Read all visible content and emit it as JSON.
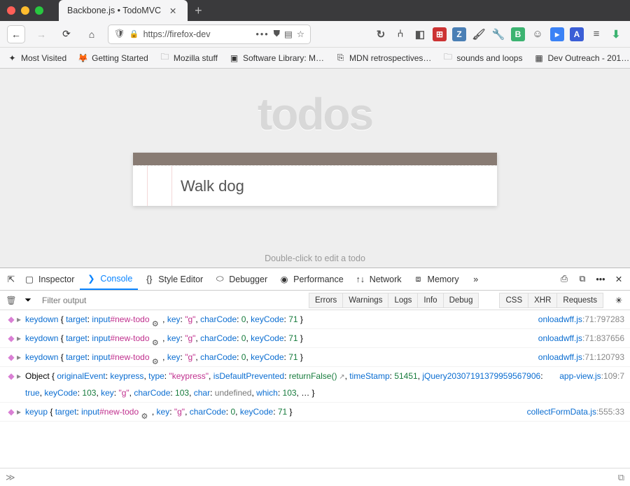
{
  "window": {
    "tab_title": "Backbone.js • TodoMVC"
  },
  "url": "https://firefox-dev",
  "bookmarks": [
    {
      "label": "Most Visited",
      "icon": "✦"
    },
    {
      "label": "Getting Started",
      "icon": "🦊"
    },
    {
      "label": "Mozilla stuff",
      "icon": "folder"
    },
    {
      "label": "Software Library: M…",
      "icon": "▣"
    },
    {
      "label": "MDN retrospectives…",
      "icon": "⎘"
    },
    {
      "label": "sounds and loops",
      "icon": "folder"
    },
    {
      "label": "Dev Outreach - 201…",
      "icon": "▦"
    }
  ],
  "app": {
    "heading": "todos",
    "input_value": "Walk dog",
    "hint": "Double-click to edit a todo"
  },
  "devtools": {
    "tabs": [
      "Inspector",
      "Console",
      "Style Editor",
      "Debugger",
      "Performance",
      "Network",
      "Memory"
    ],
    "active_tab": "Console",
    "filter_placeholder": "Filter output",
    "filter_buttons_a": [
      "Errors",
      "Warnings",
      "Logs",
      "Info",
      "Debug"
    ],
    "filter_buttons_b": [
      "CSS",
      "XHR",
      "Requests"
    ]
  },
  "console": [
    {
      "type": "keyevent",
      "html": "<span class='k-event'>keydown</span> { <span class='k-prop'>target</span>: <span class='k-sel'>input</span><span class='k-id'>#new-todo</span> <span class='gearchip'></span> , <span class='k-prop'>key</span>: <span class='k-str'>\"g\"</span>, <span class='k-prop'>charCode</span>: <span class='k-num'>0</span>, <span class='k-prop'>keyCode</span>: <span class='k-num'>71</span> }",
      "loc_file": "onloadwff.js",
      "loc_pos": "71:797283"
    },
    {
      "type": "keyevent",
      "html": "<span class='k-event'>keydown</span> { <span class='k-prop'>target</span>: <span class='k-sel'>input</span><span class='k-id'>#new-todo</span> <span class='gearchip'></span> , <span class='k-prop'>key</span>: <span class='k-str'>\"g\"</span>, <span class='k-prop'>charCode</span>: <span class='k-num'>0</span>, <span class='k-prop'>keyCode</span>: <span class='k-num'>71</span> }",
      "loc_file": "onloadwff.js",
      "loc_pos": "71:837656"
    },
    {
      "type": "keyevent",
      "html": "<span class='k-event'>keydown</span> { <span class='k-prop'>target</span>: <span class='k-sel'>input</span><span class='k-id'>#new-todo</span> <span class='gearchip'></span> , <span class='k-prop'>key</span>: <span class='k-str'>\"g\"</span>, <span class='k-prop'>charCode</span>: <span class='k-num'>0</span>, <span class='k-prop'>keyCode</span>: <span class='k-num'>71</span> }",
      "loc_file": "onloadwff.js",
      "loc_pos": "71:120793"
    },
    {
      "type": "object",
      "html": "Object { <span class='k-prop'>originalEvent</span>: <span class='k-sel'>keypress</span>, <span class='k-prop'>type</span>: <span class='k-str'>\"keypress\"</span>, <span class='k-prop'>isDefaultPrevented</span>: <span class='k-func'>returnFalse()</span><span class='linkarrow'></span>, <span class='k-prop'>timeStamp</span>: <span class='k-num'>51451</span>, <span class='k-prop'>jQuery20307191379959567906</span>: <span class='k-bool'>true</span>, <span class='k-prop'>keyCode</span>: <span class='k-num'>103</span>, <span class='k-prop'>key</span>: <span class='k-str'>\"g\"</span>, <span class='k-prop'>charCode</span>: <span class='k-num'>103</span>, <span class='k-prop'>char</span>: <span class='k-und'>undefined</span>, <span class='k-prop'>which</span>: <span class='k-num'>103</span>, … }",
      "loc_file": "app-view.js",
      "loc_pos": "109:7"
    },
    {
      "type": "keyevent",
      "html": "<span class='k-event'>keyup</span> { <span class='k-prop'>target</span>: <span class='k-sel'>input</span><span class='k-id'>#new-todo</span> <span class='gearchip'></span> , <span class='k-prop'>key</span>: <span class='k-str'>\"g\"</span>, <span class='k-prop'>charCode</span>: <span class='k-num'>0</span>, <span class='k-prop'>keyCode</span>: <span class='k-num'>71</span> }",
      "loc_file": "collectFormData.js",
      "loc_pos": "555:33"
    }
  ]
}
